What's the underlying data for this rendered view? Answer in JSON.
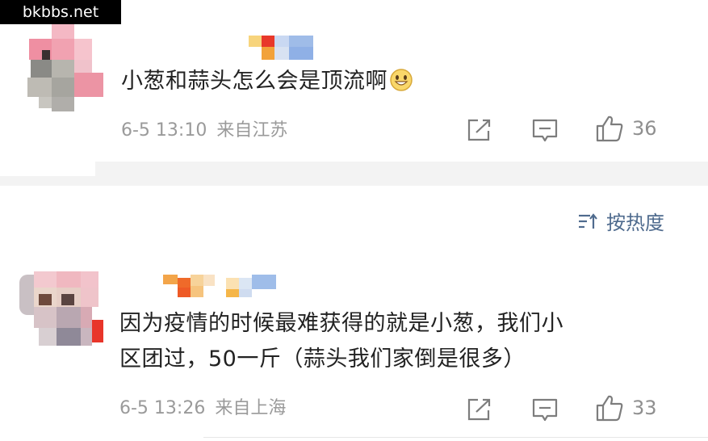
{
  "watermark": "bkbbs.net",
  "comments": [
    {
      "text": "小葱和蒜头怎么会是顶流啊",
      "emoji": "grinning-face-emoji",
      "time": "6-5 13:10",
      "location": "来自江苏",
      "likes": "36"
    },
    {
      "text_line1": "因为疫情的时候最难获得的就是小葱，我们小",
      "text_line2": "区团过，50一斤（蒜头我们家倒是很多）",
      "time": "6-5 13:26",
      "location": "来自上海",
      "likes": "33"
    }
  ],
  "sort": {
    "label": "按热度",
    "icon": "sort-icon"
  },
  "icons": {
    "share": "share-icon",
    "comment": "comment-icon",
    "like": "thumbs-up-icon"
  },
  "colors": {
    "link_blue": "#4f6b8e",
    "meta_gray": "#9a9a9a",
    "text": "#222222"
  }
}
